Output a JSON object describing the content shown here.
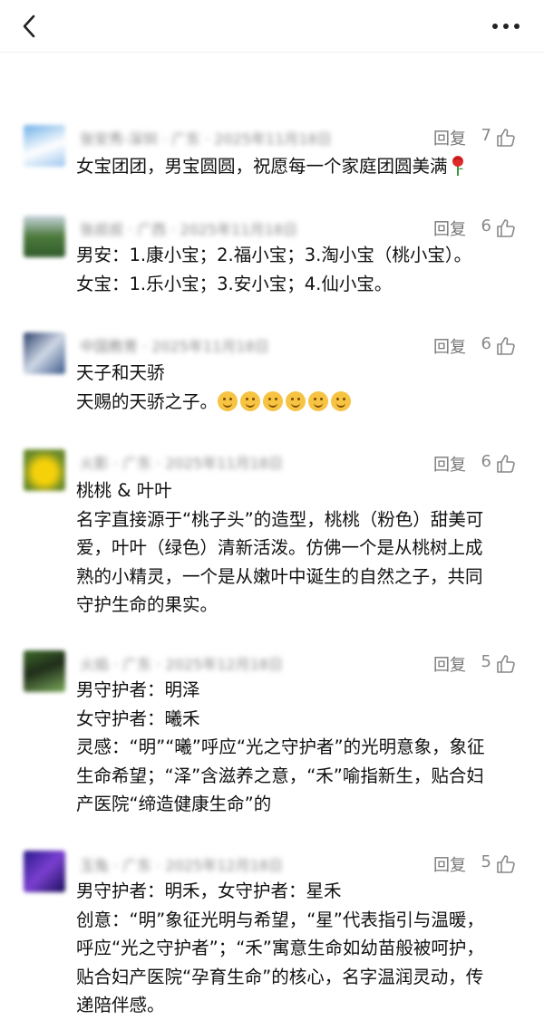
{
  "nav": {
    "back_icon": "chevron-left-icon",
    "more_icon": "more-dots-icon"
  },
  "reply_label": "回复",
  "comments": [
    {
      "meta": "张安秀-深圳 · 广东 · 2025年11月18日",
      "likes": "7",
      "lines": [
        "女宝团团，男宝圆圆，祝愿每一个家庭团圆美满"
      ],
      "emoji_icon": "rose-icon"
    },
    {
      "meta": "张叔叔 · 广西 · 2025年11月18日",
      "likes": "6",
      "lines": [
        "男安：1.康小宝；2.福小宝；3.淘小宝（桃小宝）。",
        "女宝：1.乐小宝；3.安小宝；4.仙小宝。"
      ]
    },
    {
      "meta": "中国教育 · 2025年11月18日",
      "likes": "6",
      "lines": [
        "天子和天骄",
        "天赐的天骄之子。"
      ],
      "emoji_icon": "smiling-face-icon",
      "emoji_count": 6
    },
    {
      "meta": "火影 · 广东 · 2025年11月18日",
      "likes": "6",
      "lines": [
        "桃桃 & 叶叶",
        "名字直接源于“桃子头”的造型，桃桃（粉色）甜美可",
        "爱，叶叶（绿色）清新活泼。仿佛一个是从桃树上成",
        "熟的小精灵，一个是从嫩叶中诞生的自然之子，共同",
        "守护生命的果实。"
      ]
    },
    {
      "meta": "火焰 · 广东 · 2025年12月18日",
      "likes": "5",
      "lines": [
        "男守护者：明泽",
        "女守护者：曦禾",
        "灵感：“明”“曦”呼应“光之守护者”的光明意象，象征",
        "生命希望；“泽”含滋养之意，“禾”喻指新生，贴合妇",
        "产医院“缔造健康生命”的"
      ]
    },
    {
      "meta": "玉兔 · 广东 · 2025年12月18日",
      "likes": "5",
      "lines": [
        "男守护者：明禾，女守护者：星禾",
        "创意：“明”象征光明与希望，“星”代表指引与温暖，",
        "呼应“光之守护者”；“禾”寓意生命如幼苗般被呵护，",
        "贴合妇产医院“孕育生命”的核心，名字温润灵动，传",
        "递陪伴感。"
      ]
    }
  ]
}
